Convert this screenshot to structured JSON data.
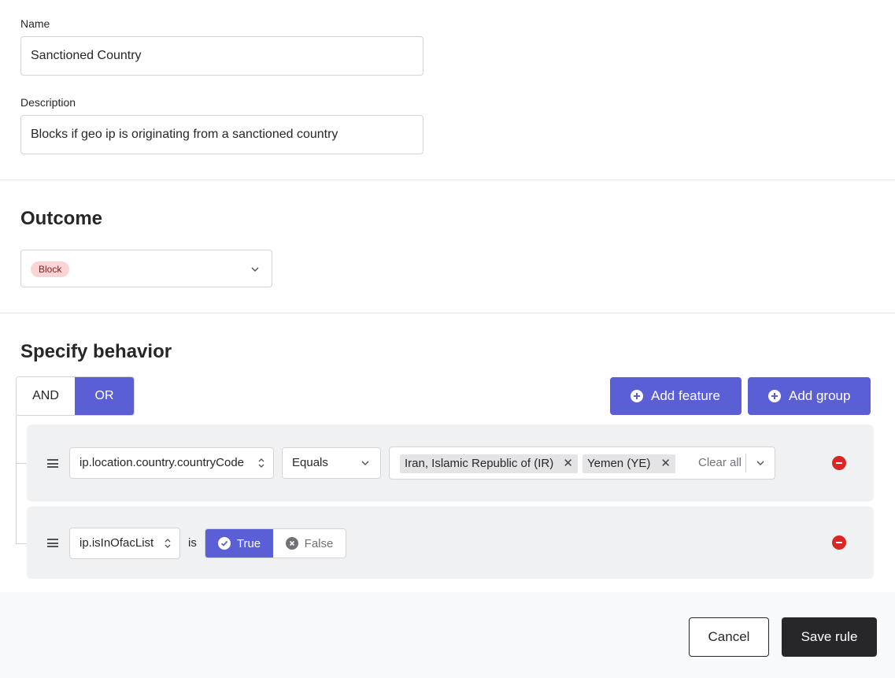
{
  "form": {
    "name_label": "Name",
    "name_value": "Sanctioned Country",
    "description_label": "Description",
    "description_value": "Blocks if geo ip is originating from a sanctioned country"
  },
  "outcome": {
    "title": "Outcome",
    "selected": "Block"
  },
  "behavior": {
    "title": "Specify behavior",
    "logic_and": "AND",
    "logic_or": "OR",
    "logic_selected": "OR",
    "add_feature_label": "Add feature",
    "add_group_label": "Add group"
  },
  "rules": [
    {
      "feature": "ip.location.country.countryCode",
      "operator": "Equals",
      "tags": [
        "Iran, Islamic Republic of (IR)",
        "Yemen (YE)"
      ],
      "clear_all": "Clear all"
    },
    {
      "feature": "ip.isInOfacList",
      "connector": "is",
      "true_label": "True",
      "false_label": "False",
      "selected": "True"
    }
  ],
  "footer": {
    "cancel_label": "Cancel",
    "save_label": "Save rule"
  },
  "colors": {
    "accent": "#5b5fd6",
    "danger": "#dc2626",
    "badge_bg": "#fbd5d5",
    "dark": "#27272a"
  }
}
